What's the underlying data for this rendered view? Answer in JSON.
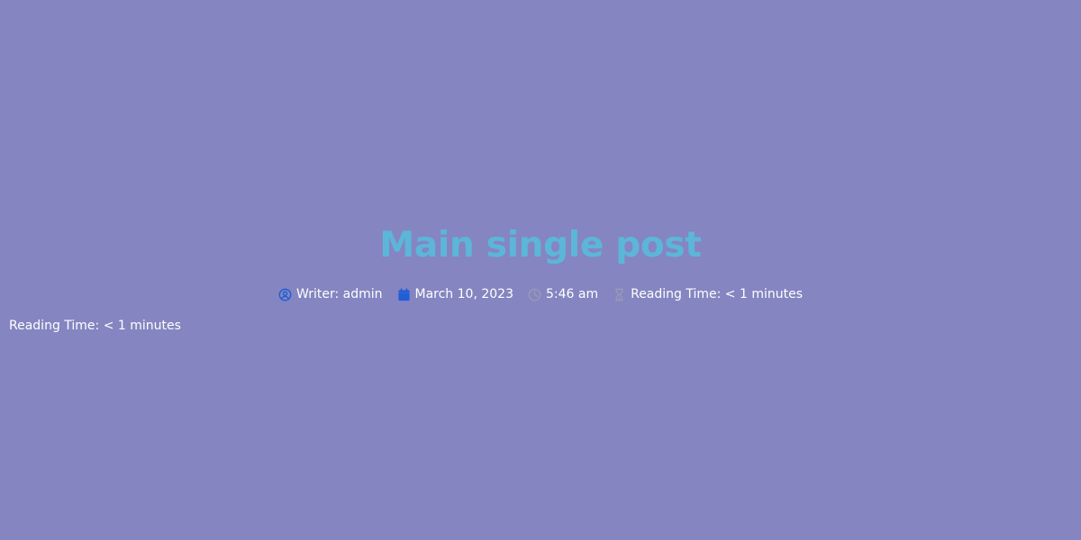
{
  "post": {
    "title": "Main single post"
  },
  "meta": {
    "writer": "Writer: admin",
    "date": "March 10, 2023",
    "time": "5:46 am",
    "reading_time": "Reading Time: < 1 minutes"
  },
  "content": {
    "reading_time": "Reading Time: < 1 minutes"
  },
  "icons": {
    "writer": "user-circle-icon",
    "date": "calendar-icon",
    "time": "clock-icon",
    "reading_time": "hourglass-icon"
  },
  "colors": {
    "background": "#8585c1",
    "title": "#5cb6d8",
    "meta_text": "#ffffff",
    "writer_icon": "#1f5fd6",
    "date_icon": "#1f5fd6",
    "time_icon": "#9a9ab8",
    "reading_icon": "#9a9ab8"
  }
}
